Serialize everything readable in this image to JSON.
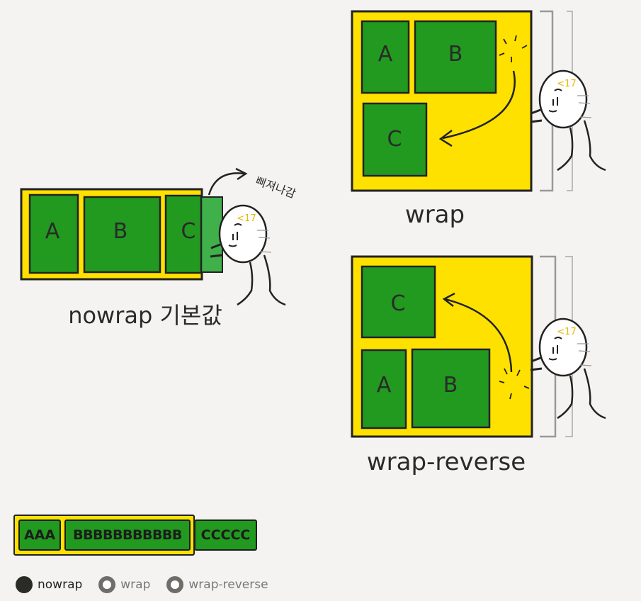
{
  "diagram": {
    "wrap_panel": {
      "items": [
        "A",
        "B",
        "C"
      ],
      "caption": "wrap"
    },
    "wrap_reverse_panel": {
      "items": [
        "C",
        "A",
        "B"
      ],
      "caption": "wrap-reverse"
    },
    "nowrap_panel": {
      "items": [
        "A",
        "B",
        "C"
      ],
      "caption": "nowrap 기본값",
      "overflow_note": "삐져나감"
    },
    "character_badge": "<17"
  },
  "demo": {
    "items": [
      "AAA",
      "BBBBBBBBBBB",
      "CCCCC"
    ]
  },
  "options": [
    {
      "label": "nowrap",
      "checked": true
    },
    {
      "label": "wrap",
      "checked": false
    },
    {
      "label": "wrap-reverse",
      "checked": false
    }
  ],
  "colors": {
    "container": "#ffe100",
    "item": "#219a1f",
    "outline": "#222222",
    "background": "#f4f3f1"
  }
}
